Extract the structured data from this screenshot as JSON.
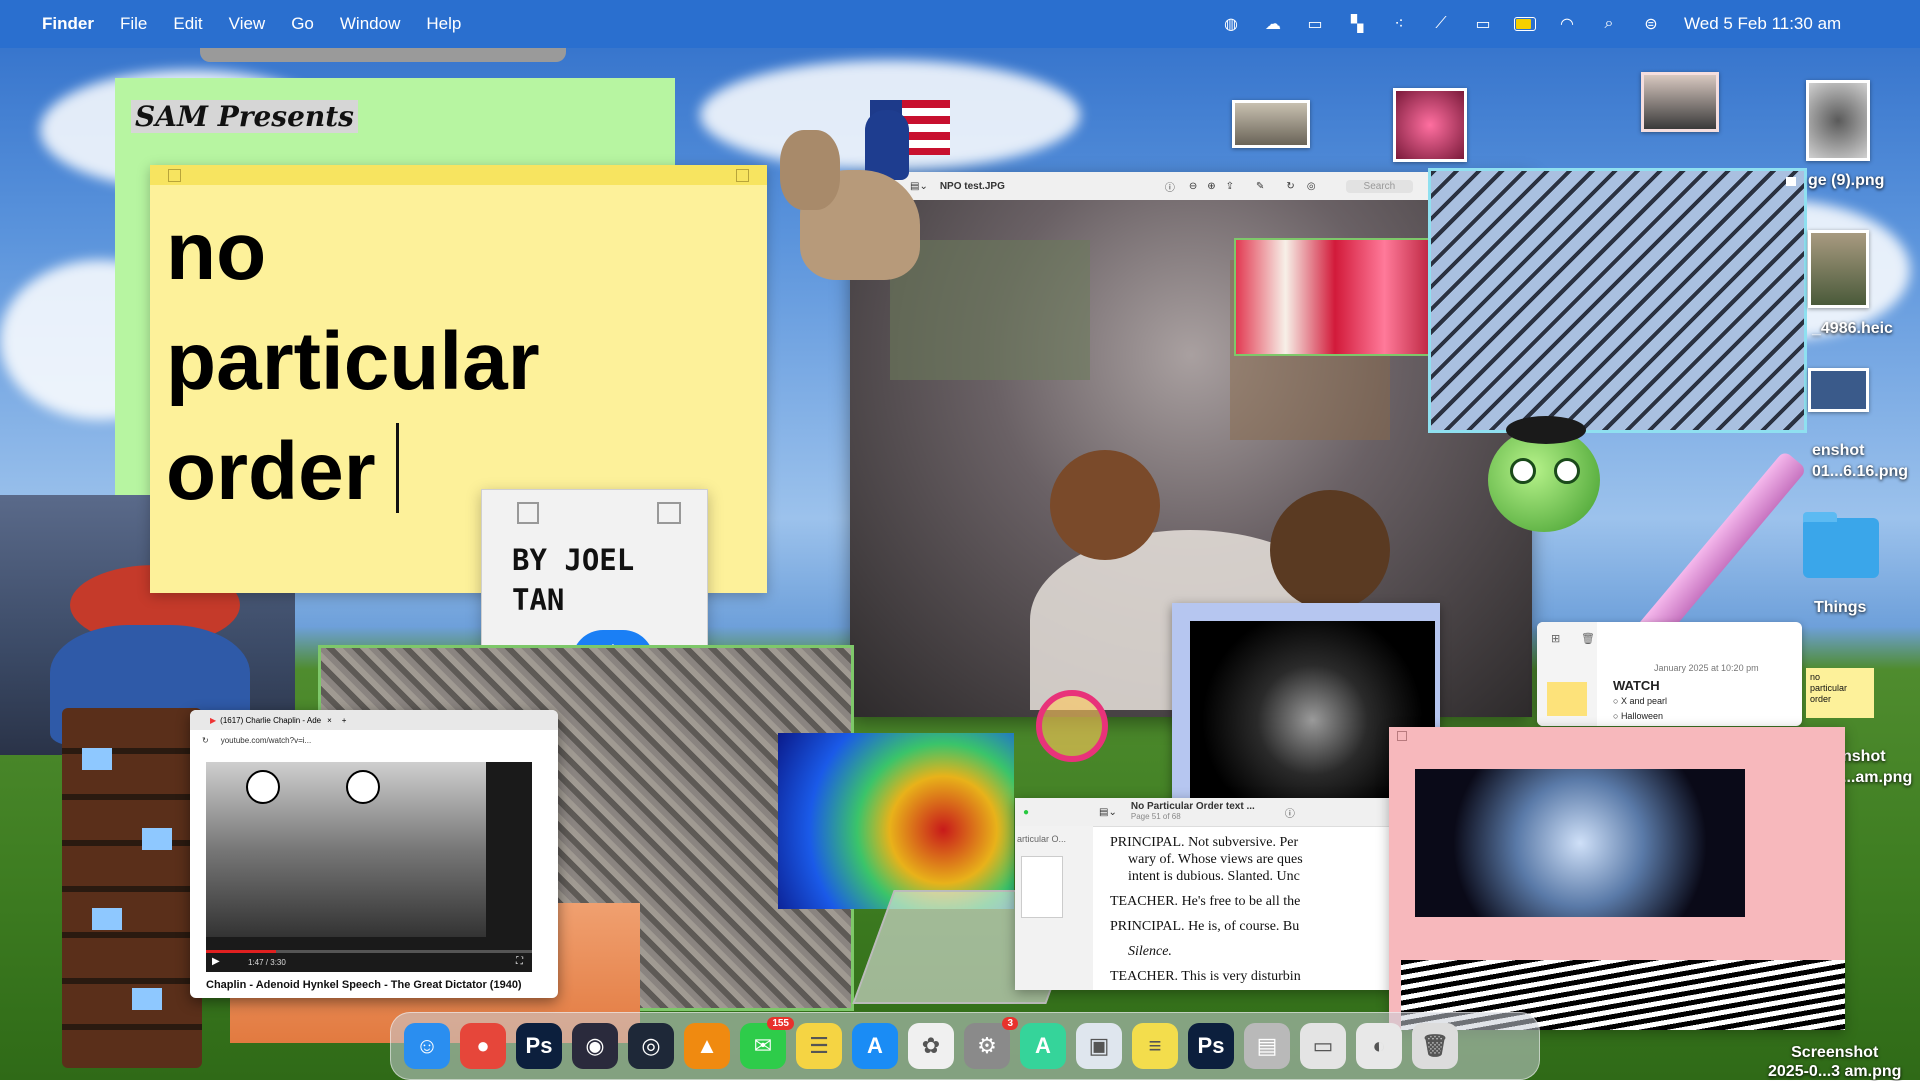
{
  "menubar": {
    "app_name": "Finder",
    "menus": [
      "File",
      "Edit",
      "View",
      "Go",
      "Window",
      "Help"
    ],
    "clock": "Wed 5 Feb  11:30 am"
  },
  "notes": {
    "green_heading": "SAM Presents",
    "big_text": "no\nparticular\norder",
    "byline": "BY JOEL\nTAN"
  },
  "preview": {
    "title": "NPO test.JPG",
    "search_placeholder": "Search"
  },
  "youtube": {
    "tab_title": "(1617) Charlie Chaplin - Ade",
    "url": "youtube.com/watch?v=i...",
    "time": "1:47 / 3:30",
    "caption": "Chaplin - Adenoid Hynkel Speech - The Great Dictator (1940)"
  },
  "document": {
    "title": "No Particular Order text ...",
    "page": "Page 51 of 68",
    "sidebar_label": "articular O...",
    "lines": [
      {
        "speaker": "PRINCIPAL.",
        "text": " Not subversive. Per"
      },
      {
        "speaker": "",
        "text": "wary of. Whose views are ques"
      },
      {
        "speaker": "",
        "text": "intent is dubious. Slanted. Unc"
      },
      {
        "speaker": "TEACHER.",
        "text": " He's free to be all the"
      },
      {
        "speaker": "PRINCIPAL.",
        "text": " He is, of course. Bu"
      },
      {
        "speaker": "",
        "text": "Silence."
      },
      {
        "speaker": "TEACHER.",
        "text": " This is very disturbin"
      }
    ]
  },
  "reminders": {
    "date": "January 2025 at 10:20 pm",
    "heading": "WATCH",
    "items": [
      "X and pearl",
      "Halloween"
    ],
    "mini_note": "no\nparticular\norder"
  },
  "desktop_files": [
    {
      "label": "ge (9).png"
    },
    {
      "label": "_4986.heic"
    },
    {
      "label": "enshot\n01...6.16.png"
    },
    {
      "label": "Things"
    },
    {
      "label": "nshot\n...am.png"
    },
    {
      "label": "Screenshot\n2025-0...3 am.png"
    }
  ],
  "dock": {
    "apps": [
      {
        "name": "finder-icon",
        "glyph": "☺",
        "color": "#2a8ef0"
      },
      {
        "name": "chrome-icon",
        "glyph": "●",
        "color": "#e6463a"
      },
      {
        "name": "photoshop-icon",
        "glyph": "Ps",
        "color": "#0c1f3d"
      },
      {
        "name": "obs-icon",
        "glyph": "◉",
        "color": "#2a2a3c"
      },
      {
        "name": "camera-app-icon",
        "glyph": "◎",
        "color": "#1e2838"
      },
      {
        "name": "vlc-icon",
        "glyph": "▲",
        "color": "#f08a10"
      },
      {
        "name": "messages-icon",
        "glyph": "✉",
        "color": "#2ecc4a",
        "badge": "155"
      },
      {
        "name": "notes-icon",
        "glyph": "☰",
        "color": "#f5d443"
      },
      {
        "name": "app-store-icon",
        "glyph": "A",
        "color": "#1a8cf5"
      },
      {
        "name": "photos-icon",
        "glyph": "✿",
        "color": "#f0f0f0"
      },
      {
        "name": "settings-icon",
        "glyph": "⚙",
        "color": "#8a8a8a",
        "badge": "3"
      },
      {
        "name": "font-app-icon",
        "glyph": "A",
        "color": "#35d49a"
      },
      {
        "name": "preview-icon",
        "glyph": "▣",
        "color": "#dfe6ee"
      },
      {
        "name": "stickies-icon",
        "glyph": "≡",
        "color": "#f3dd4c"
      },
      {
        "name": "photoshop-icon-2",
        "glyph": "Ps",
        "color": "#0c1f3d"
      },
      {
        "name": "downloads-stack-icon",
        "glyph": "▤",
        "color": "#b9b9b9"
      },
      {
        "name": "document-stack-icon",
        "glyph": "▭",
        "color": "#e4e4e4"
      },
      {
        "name": "chrome-window-icon",
        "glyph": "◐",
        "color": "#e8e8e8"
      },
      {
        "name": "trash-icon",
        "glyph": "🗑",
        "color": "#dcdcdc"
      }
    ]
  }
}
